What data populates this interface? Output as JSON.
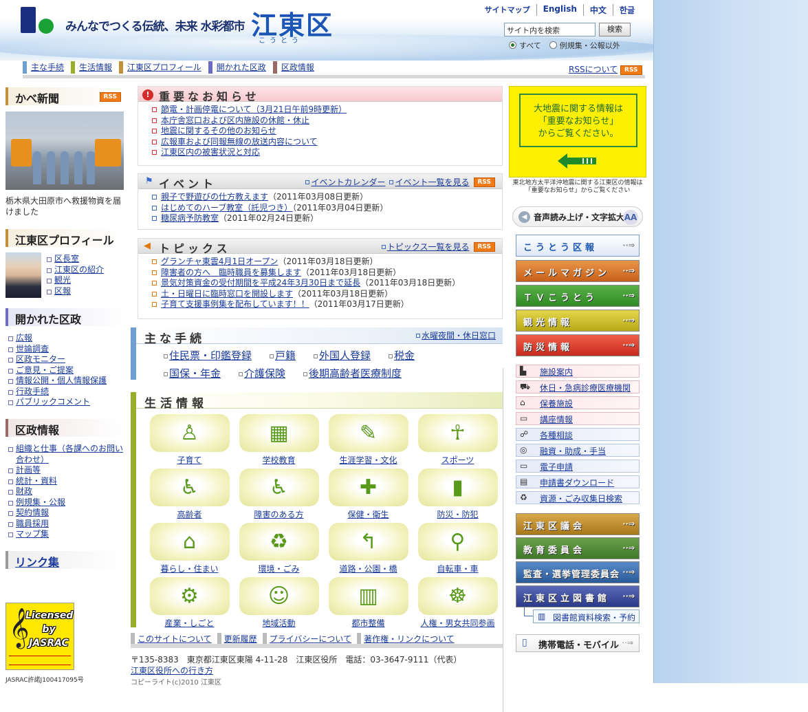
{
  "header": {
    "tagline": "みんなでつくる伝統、未来 水彩都市",
    "ward_name": "江東区",
    "ward_ruby": "こうとう",
    "toplinks": [
      "サイトマップ",
      "English",
      "中文",
      "한글"
    ],
    "search_placeholder": "サイト内を検索",
    "search_button": "検索",
    "radio_all": "すべて",
    "radio_except": "例規集・公報以外"
  },
  "gnav": {
    "items": [
      "主な手続",
      "生活情報",
      "江東区プロフィール",
      "開かれた区政",
      "区政情報"
    ],
    "rss_about": "RSSについて",
    "rss": "RSS"
  },
  "left": {
    "kabe_title": "かべ新聞",
    "kabe_caption": "栃木県大田原市へ救援物資を届けました",
    "profile_title": "江東区プロフィール",
    "profile_links": [
      "区長室",
      "江東区の紹介",
      "観光",
      "区報"
    ],
    "open_title": "開かれた区政",
    "open_links": [
      "広報",
      "世論調査",
      "区政モニター",
      "ご意見・ご提案",
      "情報公開・個人情報保護",
      "行政手続",
      "パブリックコメント"
    ],
    "admin_title": "区政情報",
    "admin_links": [
      "組織と仕事（各課へのお問い合わせ）",
      "計画等",
      "統計・資料",
      "財政",
      "例規集・公報",
      "契約情報",
      "職員採用",
      "マップ集"
    ],
    "links_title": "リンク集",
    "jasrac_text": "Licensed by JASRAC",
    "jasrac_no": "JASRAC許諾J100417095号"
  },
  "important": {
    "title": "重要なお知らせ",
    "items": [
      "節電・計画停電について（3月21日午前9時更新）",
      "本庁舎窓口および区内施設の休館・休止",
      "地震に関するその他のお知らせ",
      "広報車および同報無線の放送内容について",
      "江東区内の被害状況と対応"
    ]
  },
  "event": {
    "title": "イベント",
    "calendar_link": "イベントカレンダー",
    "list_link": "イベント一覧を見る",
    "items": [
      {
        "t": "親子で野遊びの仕方教えます",
        "d": "（2011年03月08日更新）"
      },
      {
        "t": "はじめてのハーブ教室（託児つき）",
        "d": "（2011年03月04日更新）"
      },
      {
        "t": "糖尿病予防教室",
        "d": "（2011年02月24日更新）"
      }
    ]
  },
  "topics": {
    "title": "トピックス",
    "list_link": "トピックス一覧を見る",
    "items": [
      {
        "t": "グランチャ東雲4月1日オープン",
        "d": "（2011年03月18日更新）"
      },
      {
        "t": "障害者の方へ　臨時職員を募集します",
        "d": "（2011年03月18日更新）"
      },
      {
        "t": "景気対策資金の受付期間を平成24年3月30日まで延長",
        "d": "（2011年03月18日更新）"
      },
      {
        "t": "土・日曜日に臨時窓口を開設します",
        "d": "（2011年03月18日更新）"
      },
      {
        "t": "子育て支援事例集を配布しています！！",
        "d": "（2011年03月17日更新）"
      }
    ]
  },
  "procedures": {
    "title": "主な手続",
    "night_link": "水曜夜間・休日窓口",
    "items": [
      "住民票・印鑑登録",
      "戸籍",
      "外国人登録",
      "税金",
      "国保・年金",
      "介護保険",
      "後期高齢者医療制度"
    ]
  },
  "life": {
    "title": "生活情報",
    "tiles": [
      {
        "label": "子育て",
        "icon": "baby-icon",
        "g": "♙"
      },
      {
        "label": "学校教育",
        "icon": "school-icon",
        "g": "▦"
      },
      {
        "label": "生涯学習・文化",
        "icon": "book-icon",
        "g": "✎"
      },
      {
        "label": "スポーツ",
        "icon": "runner-icon",
        "g": "☥"
      },
      {
        "label": "高齢者",
        "icon": "elder-icon",
        "g": "♿"
      },
      {
        "label": "障害のある方",
        "icon": "wheelchair-icon",
        "g": "♿"
      },
      {
        "label": "保健・衛生",
        "icon": "health-icon",
        "g": "✚"
      },
      {
        "label": "防災・防犯",
        "icon": "extinguisher-icon",
        "g": "▮"
      },
      {
        "label": "暮らし・住まい",
        "icon": "house-icon",
        "g": "⌂"
      },
      {
        "label": "環境・ごみ",
        "icon": "trash-icon",
        "g": "♻"
      },
      {
        "label": "道路・公園・橋",
        "icon": "road-icon",
        "g": "↰"
      },
      {
        "label": "自転車・車",
        "icon": "bicycle-icon",
        "g": "⚲"
      },
      {
        "label": "産業・しごと",
        "icon": "gear-icon",
        "g": "⚙"
      },
      {
        "label": "地域活動",
        "icon": "people-icon",
        "g": "☺"
      },
      {
        "label": "都市整備",
        "icon": "buildings-icon",
        "g": "▥"
      },
      {
        "label": "人権・男女共同参画",
        "icon": "handshake-icon",
        "g": "☸"
      }
    ]
  },
  "footer": {
    "links": [
      "このサイトについて",
      "更新履歴",
      "プライバシーについて",
      "著作権・リンクについて"
    ],
    "address": "〒135-8383　東京都江東区東陽 4-11-28　江東区役所　電話：03-3647-9111（代表）",
    "access": "江東区役所への行き方",
    "copyright": "コピーライト(c)2010 江東区"
  },
  "right": {
    "quake_notice": "大地震に関する情報は「重要なお知らせ」からご覧ください。",
    "quake_l1": "大地震に関する情報は",
    "quake_l2": "「重要なお知らせ」",
    "quake_l3": "からご覧ください。",
    "quake_note": "東北地方太平洋沖地震に関する江東区の情報は「重要なお知らせ」からご覧ください",
    "voice": "音声読み上げ・文字拡大",
    "banners": [
      "こうとう区報",
      "メールマガジン",
      "ＴＶこうとう",
      "観光情報",
      "防災情報"
    ],
    "facilities": [
      "施設案内",
      "休日・急病診療医療機関",
      "保養施設",
      "講座情報",
      "各種相談",
      "融資・助成・手当",
      "電子申請",
      "申請書ダウンロード",
      "資源・ごみ収集日検索"
    ],
    "org_banners": [
      "江東区議会",
      "教育委員会",
      "監査・選挙管理委員会",
      "江東区立図書館"
    ],
    "lib_search": "図書館資料検索・予約",
    "mobile": "携帯電話・モバイル"
  }
}
